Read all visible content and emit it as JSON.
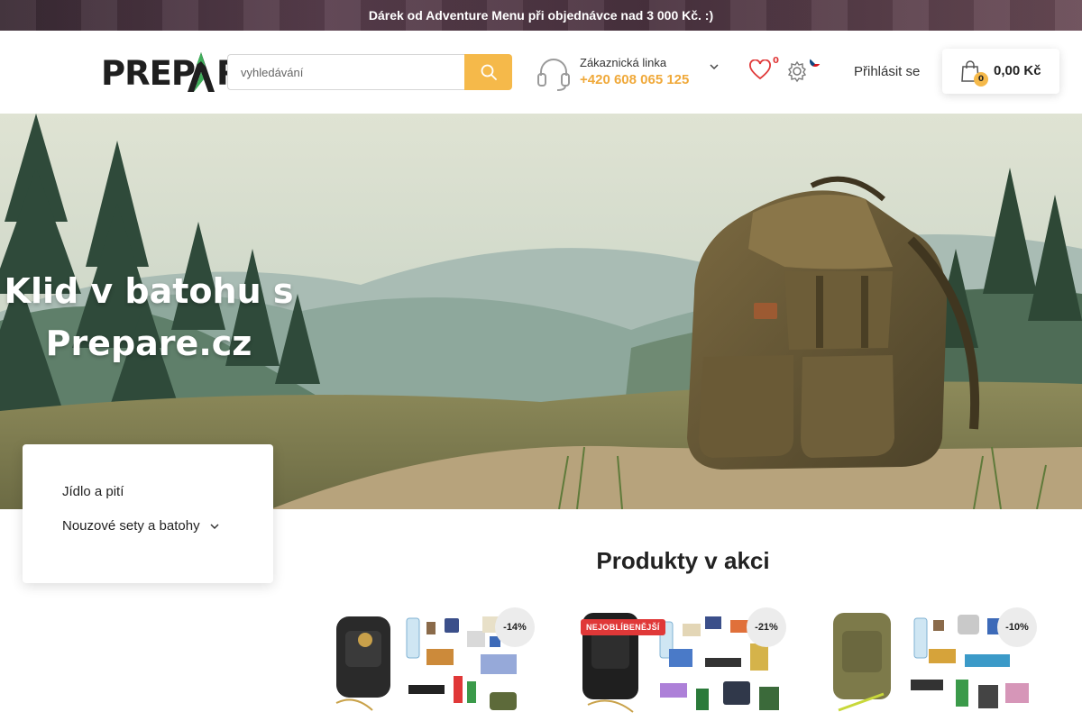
{
  "promo": {
    "text": "Dárek od Adventure Menu při objednávce nad 3 000 Kč. :)"
  },
  "header": {
    "logo_text": "PREPARE",
    "search": {
      "placeholder": "vyhledávání"
    },
    "hotline": {
      "label": "Zákaznická linka",
      "phone": "+420 608 065 125"
    },
    "wishlist_count": "0",
    "login_label": "Přihlásit se",
    "cart": {
      "count": "0",
      "total": "0,00 Kč"
    }
  },
  "hero": {
    "line1": "Klid v batohu s",
    "line2": "Prepare.cz"
  },
  "categories": [
    {
      "label": "Jídlo a pití",
      "has_submenu": false
    },
    {
      "label": "Nouzové sety a batohy",
      "has_submenu": true
    }
  ],
  "products_section": {
    "title": "Produkty v akci",
    "items": [
      {
        "discount": "-14%",
        "tag": ""
      },
      {
        "discount": "-21%",
        "tag": "NEJOBLÍBENĚJŠÍ"
      },
      {
        "discount": "-10%",
        "tag": ""
      }
    ]
  },
  "colors": {
    "accent": "#f5b94a",
    "phone": "#f0a93a",
    "badge_red": "#e03838"
  }
}
